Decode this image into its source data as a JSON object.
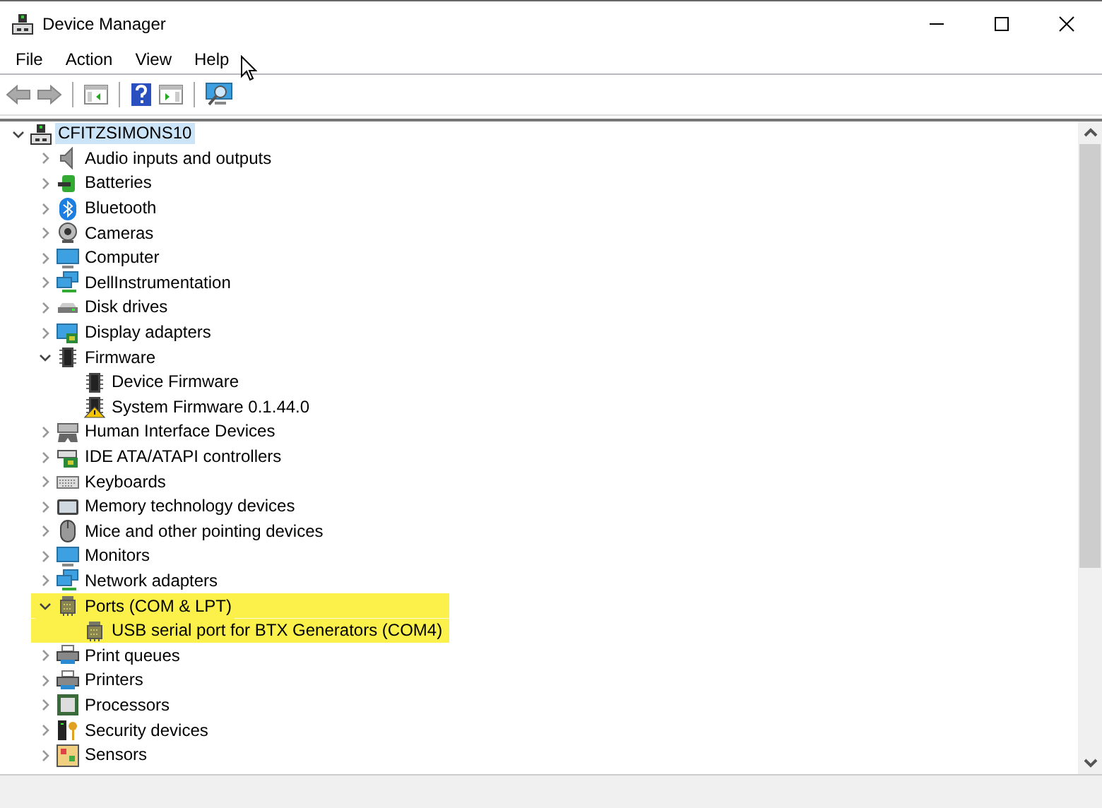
{
  "window": {
    "title": "Device Manager"
  },
  "menu": [
    "File",
    "Action",
    "View",
    "Help"
  ],
  "tree": {
    "label": "CFITZSIMONS10",
    "selected": true,
    "expanded": true,
    "children": [
      {
        "label": "Audio inputs and outputs",
        "expanded": false,
        "highlighted": false
      },
      {
        "label": "Batteries",
        "expanded": false,
        "highlighted": false
      },
      {
        "label": "Bluetooth",
        "expanded": false,
        "highlighted": false
      },
      {
        "label": "Cameras",
        "expanded": false,
        "highlighted": false
      },
      {
        "label": "Computer",
        "expanded": false,
        "highlighted": false
      },
      {
        "label": "DellInstrumentation",
        "expanded": false,
        "highlighted": false
      },
      {
        "label": "Disk drives",
        "expanded": false,
        "highlighted": false
      },
      {
        "label": "Display adapters",
        "expanded": false,
        "highlighted": false
      },
      {
        "label": "Firmware",
        "expanded": true,
        "highlighted": false,
        "children": [
          {
            "label": "Device Firmware",
            "warning": false,
            "highlighted": false
          },
          {
            "label": "System Firmware 0.1.44.0",
            "warning": true,
            "highlighted": false
          }
        ]
      },
      {
        "label": "Human Interface Devices",
        "expanded": false,
        "highlighted": false
      },
      {
        "label": "IDE ATA/ATAPI controllers",
        "expanded": false,
        "highlighted": false
      },
      {
        "label": "Keyboards",
        "expanded": false,
        "highlighted": false
      },
      {
        "label": "Memory technology devices",
        "expanded": false,
        "highlighted": false
      },
      {
        "label": "Mice and other pointing devices",
        "expanded": false,
        "highlighted": false
      },
      {
        "label": "Monitors",
        "expanded": false,
        "highlighted": false
      },
      {
        "label": "Network adapters",
        "expanded": false,
        "highlighted": false
      },
      {
        "label": "Ports (COM & LPT)",
        "expanded": true,
        "highlighted": true,
        "children": [
          {
            "label": "USB serial port for BTX Generators (COM4)",
            "highlighted": true
          }
        ]
      },
      {
        "label": "Print queues",
        "expanded": false,
        "highlighted": false
      },
      {
        "label": "Printers",
        "expanded": false,
        "highlighted": false
      },
      {
        "label": "Processors",
        "expanded": false,
        "highlighted": false
      },
      {
        "label": "Security devices",
        "expanded": false,
        "highlighted": false
      },
      {
        "label": "Sensors",
        "expanded": false,
        "highlighted": false
      }
    ]
  }
}
